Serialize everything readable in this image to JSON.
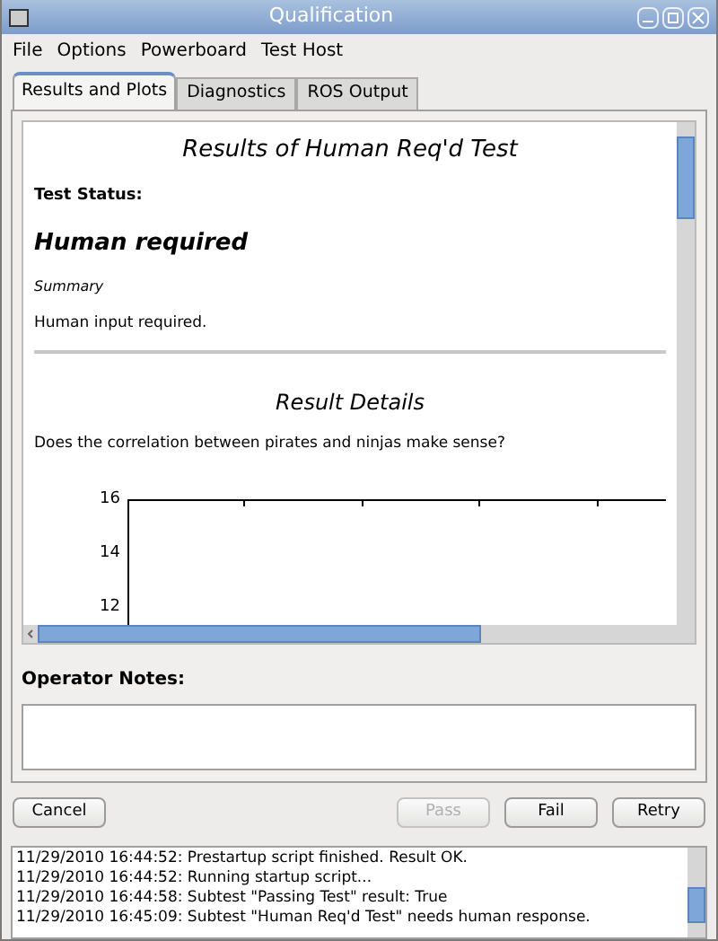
{
  "window": {
    "title": "Qualification"
  },
  "menu": [
    "File",
    "Options",
    "Powerboard",
    "Test Host"
  ],
  "tabs": [
    {
      "label": "Results and Plots",
      "selected": true
    },
    {
      "label": "Diagnostics",
      "selected": false
    },
    {
      "label": "ROS Output",
      "selected": false
    }
  ],
  "report": {
    "title": "Results of Human Req'd Test",
    "status_label": "Test Status:",
    "status": "Human required",
    "summary_label": "Summary",
    "summary": "Human input required.",
    "details_title": "Result Details",
    "question": "Does the correlation between pirates and ninjas make sense?",
    "plot_tick_labels": [
      "16",
      "14",
      "12"
    ]
  },
  "notes": {
    "label": "Operator Notes:"
  },
  "buttons": [
    {
      "label": "Cancel",
      "disabled": false
    },
    {
      "label": "Pass",
      "disabled": true
    },
    {
      "label": "Fail",
      "disabled": false
    },
    {
      "label": "Retry",
      "disabled": false
    }
  ],
  "log": [
    "11/29/2010 16:44:52: Prestartup script finished. Result OK.",
    "11/29/2010 16:44:52: Running startup script...",
    "11/29/2010 16:44:58: Subtest \"Passing Test\" result: True",
    "11/29/2010 16:45:09: Subtest \"Human Req'd Test\" needs human response."
  ]
}
